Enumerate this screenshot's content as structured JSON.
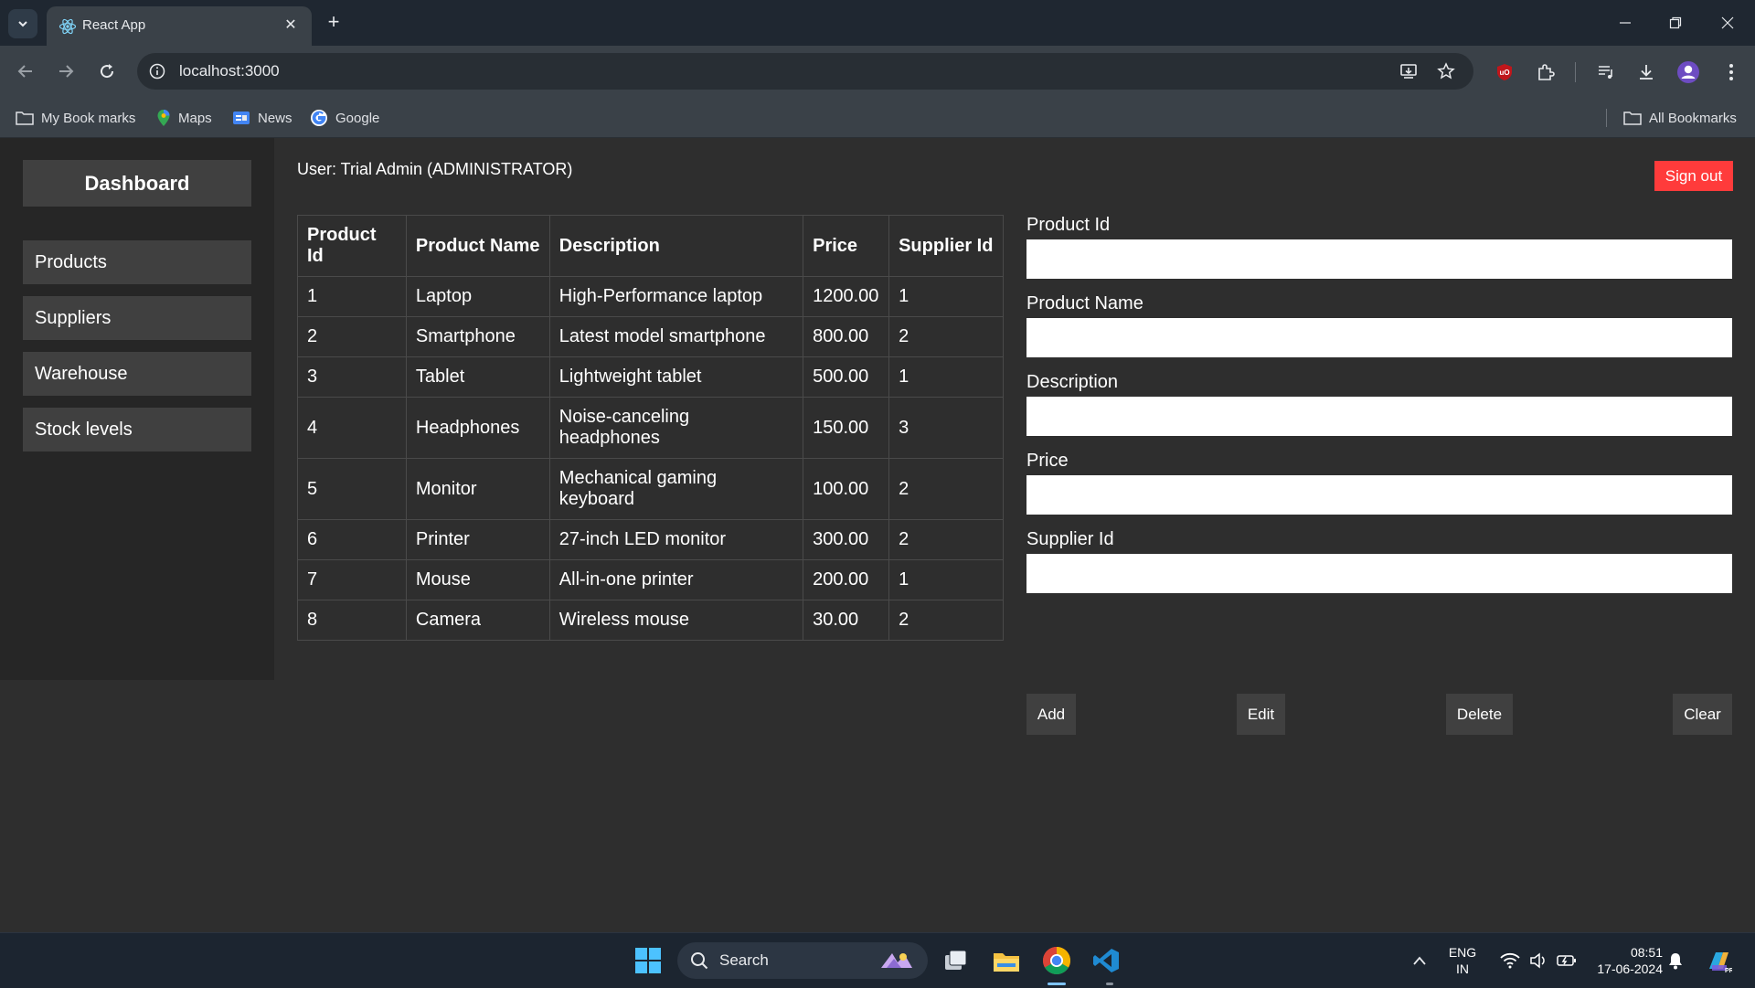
{
  "browser": {
    "tab_title": "React App",
    "url": "localhost:3000",
    "bookmarks": [
      {
        "label": "My Book marks"
      },
      {
        "label": "Maps"
      },
      {
        "label": "News"
      },
      {
        "label": "Google"
      }
    ],
    "all_bookmarks": "All Bookmarks"
  },
  "sidebar": {
    "title": "Dashboard",
    "items": [
      {
        "label": "Products"
      },
      {
        "label": "Suppliers"
      },
      {
        "label": "Warehouse"
      },
      {
        "label": "Stock levels"
      }
    ]
  },
  "header": {
    "user": "User: Trial Admin (ADMINISTRATOR)",
    "signout": "Sign out"
  },
  "table": {
    "headers": [
      "Product Id",
      "Product Name",
      "Description",
      "Price",
      "Supplier Id"
    ],
    "rows": [
      [
        "1",
        "Laptop",
        "High-Performance laptop",
        "1200.00",
        "1"
      ],
      [
        "2",
        "Smartphone",
        "Latest model smartphone",
        "800.00",
        "2"
      ],
      [
        "3",
        "Tablet",
        "Lightweight tablet",
        "500.00",
        "1"
      ],
      [
        "4",
        "Headphones",
        "Noise-canceling headphones",
        "150.00",
        "3"
      ],
      [
        "5",
        "Monitor",
        "Mechanical gaming keyboard",
        "100.00",
        "2"
      ],
      [
        "6",
        "Printer",
        "27-inch LED monitor",
        "300.00",
        "2"
      ],
      [
        "7",
        "Mouse",
        "All-in-one printer",
        "200.00",
        "1"
      ],
      [
        "8",
        "Camera",
        "Wireless mouse",
        "30.00",
        "2"
      ]
    ]
  },
  "form": {
    "fields": [
      {
        "label": "Product Id",
        "value": ""
      },
      {
        "label": "Product Name",
        "value": ""
      },
      {
        "label": "Description",
        "value": ""
      },
      {
        "label": "Price",
        "value": ""
      },
      {
        "label": "Supplier Id",
        "value": ""
      }
    ],
    "buttons": {
      "add": "Add",
      "edit": "Edit",
      "delete": "Delete",
      "clear": "Clear"
    }
  },
  "taskbar": {
    "search": "Search",
    "lang_top": "ENG",
    "lang_bottom": "IN",
    "time": "08:51",
    "date": "17-06-2024"
  },
  "colors": {
    "signout": "#ff3b3b",
    "page_bg": "#2e2e2e",
    "sidebar_bg": "#262626",
    "button_bg": "#404040"
  }
}
